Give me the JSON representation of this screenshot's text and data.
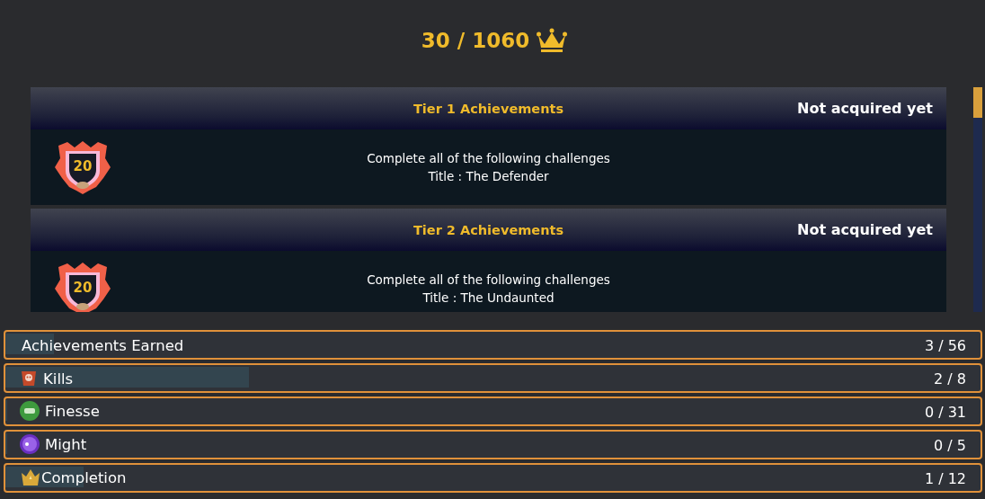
{
  "score": {
    "text": "30 / 1060"
  },
  "tiers": [
    {
      "title": "Tier 1 Achievements",
      "status": "Not acquired yet",
      "badge": "20",
      "description": "Complete all of the following challenges",
      "reward": "Title : The Defender"
    },
    {
      "title": "Tier 2 Achievements",
      "status": "Not acquired yet",
      "badge": "20",
      "description": "Complete all of the following challenges",
      "reward": "Title : The Undaunted"
    }
  ],
  "stats": [
    {
      "kind": "total",
      "label": "Achievements Earned",
      "count": "3 / 56",
      "level": 0.05
    },
    {
      "kind": "kills",
      "label": "Kills",
      "count": "2 / 8",
      "level": 0.25
    },
    {
      "kind": "finesse",
      "label": "Finesse",
      "count": "0 / 31",
      "level": 0
    },
    {
      "kind": "might",
      "label": "Might",
      "count": "0 / 5",
      "level": 0
    },
    {
      "kind": "completion",
      "label": "Completion",
      "count": "1 / 12",
      "level": 0.08
    }
  ]
}
